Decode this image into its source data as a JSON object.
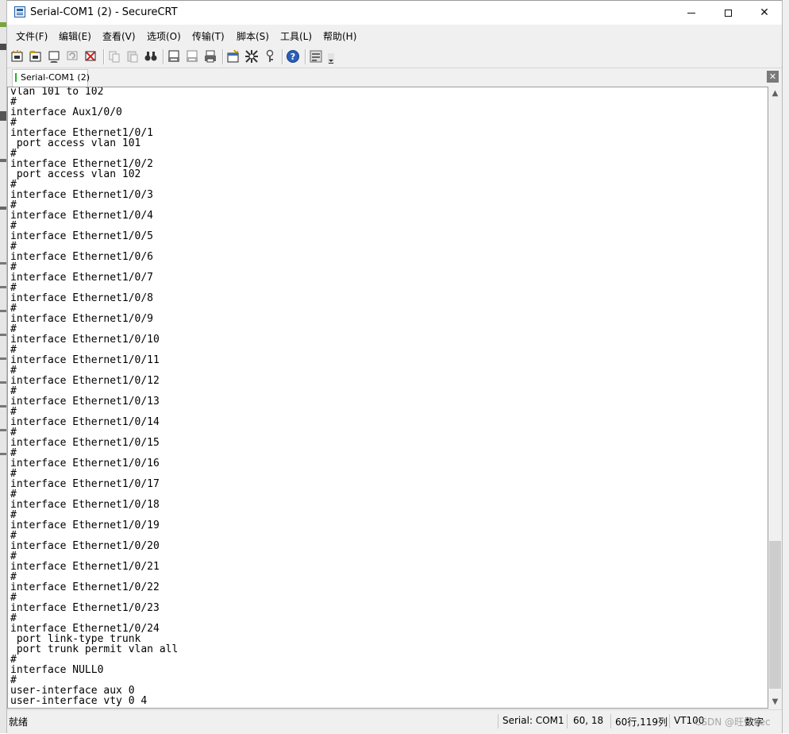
{
  "window": {
    "title": "Serial-COM1 (2) - SecureCRT",
    "minimize_glyph": "—",
    "maximize_glyph": "☐",
    "close_glyph": "✕"
  },
  "menu": {
    "items": [
      {
        "label": "文件(F)"
      },
      {
        "label": "编辑(E)"
      },
      {
        "label": "查看(V)"
      },
      {
        "label": "选项(O)"
      },
      {
        "label": "传输(T)"
      },
      {
        "label": "脚本(S)"
      },
      {
        "label": "工具(L)"
      },
      {
        "label": "帮助(H)"
      }
    ]
  },
  "toolbar": {
    "icons": [
      "quick-connect-icon",
      "connect-in-tab-icon",
      "connect-icon",
      "reconnect-icon",
      "disconnect-icon",
      "copy-icon",
      "paste-icon",
      "find-icon",
      "print-screen-icon",
      "print-selection-icon",
      "print-icon",
      "session-options-icon",
      "global-options-icon",
      "keymap-icon",
      "help-icon",
      "customize-icon"
    ]
  },
  "tabs": [
    {
      "label": "Serial-COM1 (2)",
      "status_color": "#1eb81e"
    }
  ],
  "terminal": {
    "lines": [
      "vlan 101 to 102",
      "#",
      "interface Aux1/0/0",
      "#",
      "interface Ethernet1/0/1",
      " port access vlan 101",
      "#",
      "interface Ethernet1/0/2",
      " port access vlan 102",
      "#",
      "interface Ethernet1/0/3",
      "#",
      "interface Ethernet1/0/4",
      "#",
      "interface Ethernet1/0/5",
      "#",
      "interface Ethernet1/0/6",
      "#",
      "interface Ethernet1/0/7",
      "#",
      "interface Ethernet1/0/8",
      "#",
      "interface Ethernet1/0/9",
      "#",
      "interface Ethernet1/0/10",
      "#",
      "interface Ethernet1/0/11",
      "#",
      "interface Ethernet1/0/12",
      "#",
      "interface Ethernet1/0/13",
      "#",
      "interface Ethernet1/0/14",
      "#",
      "interface Ethernet1/0/15",
      "#",
      "interface Ethernet1/0/16",
      "#",
      "interface Ethernet1/0/17",
      "#",
      "interface Ethernet1/0/18",
      "#",
      "interface Ethernet1/0/19",
      "#",
      "interface Ethernet1/0/20",
      "#",
      "interface Ethernet1/0/21",
      "#",
      "interface Ethernet1/0/22",
      "#",
      "interface Ethernet1/0/23",
      "#",
      "interface Ethernet1/0/24",
      " port link-type trunk",
      " port trunk permit vlan all",
      "#",
      "interface NULL0",
      "#",
      "user-interface aux 0",
      "user-interface vty 0 4"
    ]
  },
  "statusbar": {
    "ready": "就绪",
    "connection": "Serial: COM1",
    "cursor": "60,  18",
    "size": "60行,119列",
    "emulation": "VT100",
    "numlock": "数字",
    "watermark": "CSDN @旺仔Sec"
  }
}
